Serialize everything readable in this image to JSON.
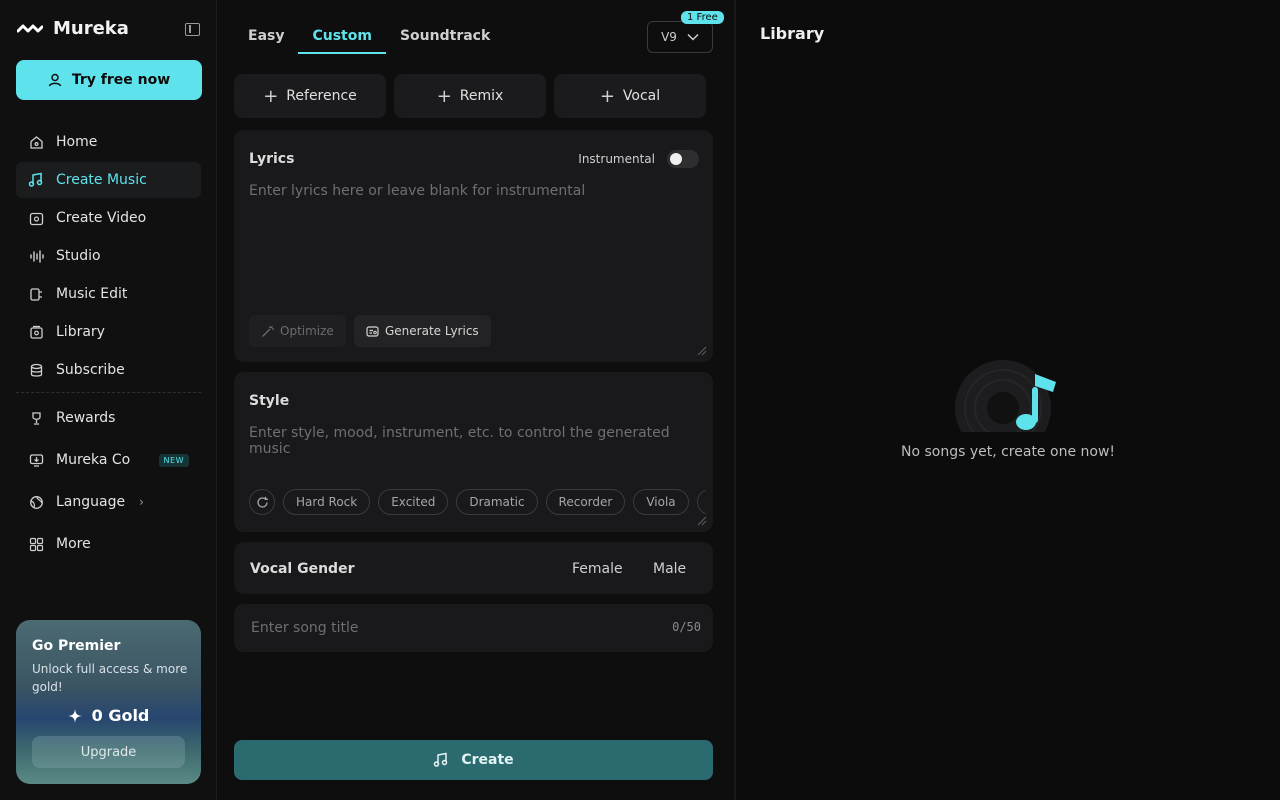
{
  "app": {
    "name": "Mureka"
  },
  "sidebar": {
    "cta_label": "Try free now",
    "items": [
      {
        "label": "Home",
        "icon": "home-icon"
      },
      {
        "label": "Create Music",
        "icon": "music-note-icon",
        "active": true
      },
      {
        "label": "Create Video",
        "icon": "video-icon"
      },
      {
        "label": "Studio",
        "icon": "waveform-icon"
      },
      {
        "label": "Music Edit",
        "icon": "edit-music-icon"
      },
      {
        "label": "Library",
        "icon": "library-icon"
      },
      {
        "label": "Subscribe",
        "icon": "database-icon"
      }
    ],
    "secondary": [
      {
        "label": "Rewards",
        "icon": "trophy-icon"
      },
      {
        "label": "Mureka Co",
        "icon": "monitor-download-icon",
        "badge": "NEW"
      },
      {
        "label": "Language",
        "icon": "globe-icon"
      },
      {
        "label": "More",
        "icon": "grid-icon"
      }
    ],
    "premier": {
      "title": "Go Premier",
      "desc": "Unlock full access & more gold!",
      "gold": "0 Gold",
      "upgrade_label": "Upgrade"
    }
  },
  "create": {
    "tabs": [
      "Easy",
      "Custom",
      "Soundtrack"
    ],
    "active_tab": "Custom",
    "version": "V9",
    "free_badge": "1 Free",
    "add_buttons": [
      "Reference",
      "Remix",
      "Vocal"
    ],
    "lyrics": {
      "title": "Lyrics",
      "instrumental_label": "Instrumental",
      "placeholder": "Enter lyrics here or leave blank for instrumental",
      "optimize_label": "Optimize",
      "generate_label": "Generate Lyrics"
    },
    "style": {
      "title": "Style",
      "placeholder": "Enter style, mood, instrument, etc. to control the generated music",
      "chips": [
        "Hard Rock",
        "Excited",
        "Dramatic",
        "Recorder",
        "Viola"
      ]
    },
    "vocal_gender": {
      "title": "Vocal Gender",
      "options": [
        "Female",
        "Male"
      ]
    },
    "song_title": {
      "placeholder": "Enter song title",
      "count": "0/50"
    },
    "create_label": "Create"
  },
  "library": {
    "title": "Library",
    "empty_text": "No songs yet, create one now!"
  },
  "colors": {
    "accent": "#5ee3ec",
    "create_button": "#2b6b70"
  }
}
